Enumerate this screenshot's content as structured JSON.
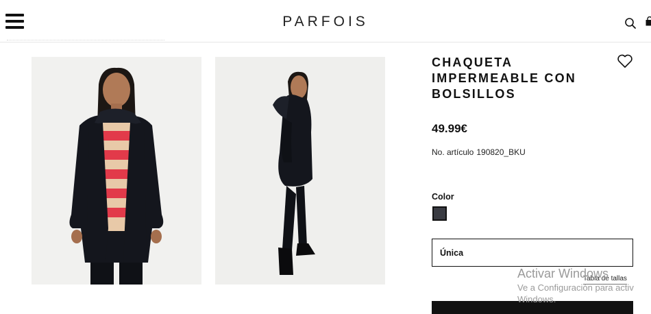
{
  "header": {
    "logo": "PARFOIS",
    "menu_icon": "hamburger-menu-icon",
    "search_icon": "search-icon",
    "bag_icon": "shopping-bag-icon"
  },
  "product": {
    "title_lines": [
      "CHAQUETA",
      "IMPERMEABLE CON",
      "BOLSILLOS"
    ],
    "price": "49.99€",
    "sku_label": "No. artículo",
    "sku_value": "190820_BKU",
    "wishlist_icon": "heart-icon",
    "color_label": "Color",
    "color_swatch": "#393b42",
    "size_selected": "Única",
    "size_guide_link": "Tabla de tallas",
    "photos": [
      "front-view-photo",
      "side-view-photo"
    ]
  },
  "os_watermark": {
    "line1": "Activar Windows",
    "line2": "Ve a Configuración para activ",
    "line3": "Windows."
  }
}
